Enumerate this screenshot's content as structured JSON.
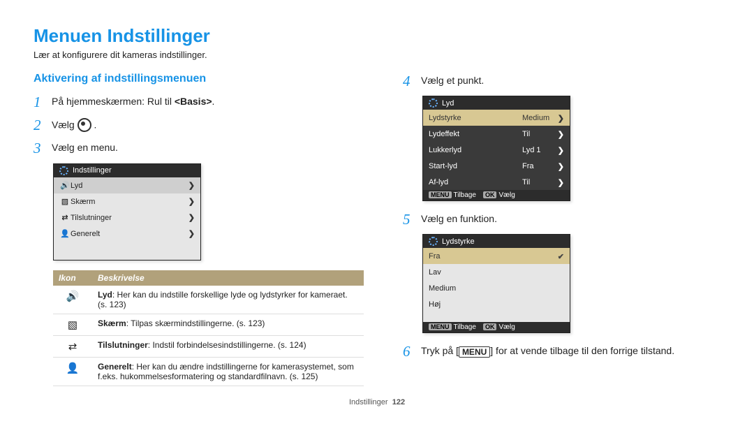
{
  "title": "Menuen Indstillinger",
  "subtitle": "Lær at konfigurere dit kameras indstillinger.",
  "section_heading": "Aktivering af indstillingsmenuen",
  "steps_left": [
    {
      "n": "1",
      "pre": "På hjemmeskærmen: Rul til ",
      "bold": "<Basis>",
      "post": "."
    },
    {
      "n": "2",
      "pre": "Vælg ",
      "icon": "dial",
      "post": "."
    },
    {
      "n": "3",
      "text": "Vælg en menu."
    }
  ],
  "steps_right": [
    {
      "n": "4",
      "text": "Vælg et punkt."
    },
    {
      "n": "5",
      "text": "Vælg en funktion."
    },
    {
      "n": "6",
      "pre": "Tryk på [",
      "icon": "menu",
      "icon_text": "MENU",
      "post": "] for at vende tilbage til den forrige tilstand."
    }
  ],
  "mock_menu_a": {
    "title": "Indstillinger",
    "items": [
      {
        "icon": "🔊",
        "label": "Lyd",
        "sel": true
      },
      {
        "icon": "▧",
        "label": "Skærm"
      },
      {
        "icon": "⇄",
        "label": "Tilslutninger"
      },
      {
        "icon": "👤",
        "label": "Generelt"
      }
    ]
  },
  "mock_menu_b": {
    "title": "Lyd",
    "items": [
      {
        "label": "Lydstyrke",
        "val": "Medium",
        "sel": true
      },
      {
        "label": "Lydeffekt",
        "val": "Til"
      },
      {
        "label": "Lukkerlyd",
        "val": "Lyd 1"
      },
      {
        "label": "Start-lyd",
        "val": "Fra"
      },
      {
        "label": "Af-lyd",
        "val": "Til"
      }
    ],
    "footer": {
      "back_btn": "MENU",
      "back": "Tilbage",
      "ok_btn": "OK",
      "ok": "Vælg"
    }
  },
  "mock_menu_c": {
    "title": "Lydstyrke",
    "items": [
      {
        "label": "Fra",
        "check": true
      },
      {
        "label": "Lav"
      },
      {
        "label": "Medium"
      },
      {
        "label": "Høj"
      }
    ],
    "footer": {
      "back_btn": "MENU",
      "back": "Tilbage",
      "ok_btn": "OK",
      "ok": "Vælg"
    }
  },
  "desc_table": {
    "headers": [
      "Ikon",
      "Beskrivelse"
    ],
    "rows": [
      {
        "icon": "🔊",
        "bold": "Lyd",
        "text": ": Her kan du indstille forskellige lyde og lydstyrker for kameraet. (s. 123)"
      },
      {
        "icon": "▧",
        "bold": "Skærm",
        "text": ": Tilpas skærmindstillingerne. (s. 123)"
      },
      {
        "icon": "⇄",
        "bold": "Tilslutninger",
        "text": ": Indstil forbindelsesindstillingerne. (s. 124)"
      },
      {
        "icon": "👤",
        "bold": "Generelt",
        "text": ": Her kan du ændre indstillingerne for kamerasystemet, som f.eks. hukommelsesformatering og standardfilnavn. (s. 125)"
      }
    ]
  },
  "footer": {
    "section": "Indstillinger",
    "page": "122"
  }
}
